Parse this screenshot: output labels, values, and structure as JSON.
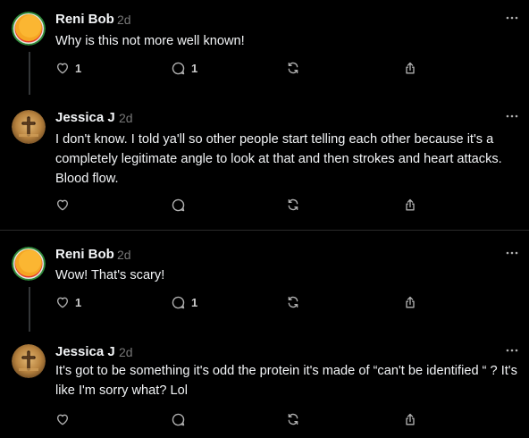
{
  "colors": {
    "background": "#000000",
    "text": "#f3f5f7",
    "secondary": "#777777",
    "icon": "#b0b0b0",
    "divider": "#2a2a2a"
  },
  "posts": [
    {
      "author": "Reni Bob",
      "time": "2d",
      "avatar": "orange-circle-avatar",
      "text": "Why is this not more well known!",
      "likes": "1",
      "replies": "1"
    },
    {
      "author": "Jessica J",
      "time": "2d",
      "avatar": "cross-photo-avatar",
      "text": "I don't know. I told ya'll so other people start telling each other because it's a completely legitimate angle to look at that and then strokes and heart attacks. Blood flow.",
      "likes": "",
      "replies": ""
    },
    {
      "author": "Reni Bob",
      "time": "2d",
      "avatar": "orange-circle-avatar",
      "text": "Wow! That's scary!",
      "likes": "1",
      "replies": "1"
    },
    {
      "author": "Jessica J",
      "time": "2d",
      "avatar": "cross-photo-avatar",
      "text": "It's got to be something it's odd the protein it's made of “can't be identified “ ? It's like I'm sorry what? Lol",
      "likes": "",
      "replies": ""
    }
  ]
}
